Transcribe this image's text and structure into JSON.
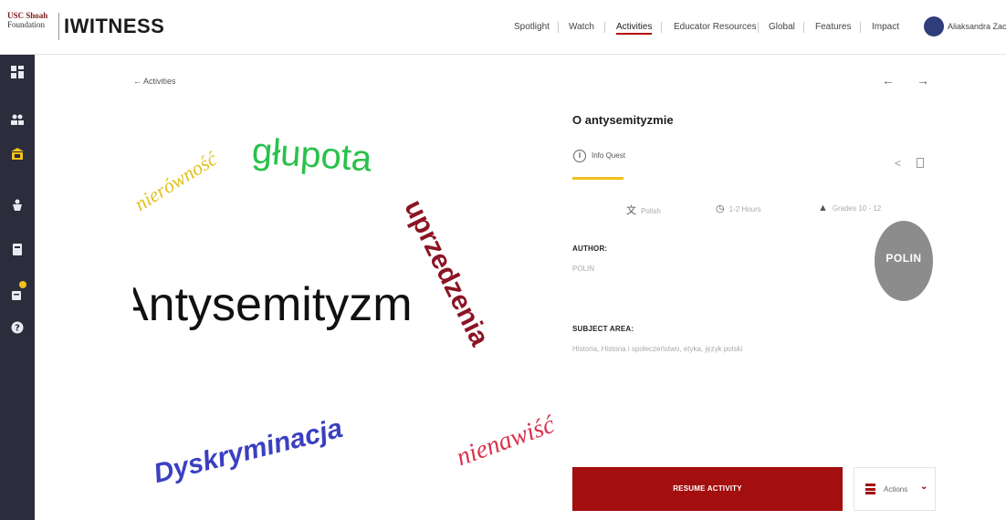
{
  "header": {
    "usc_logo_line1": "USC Shoah",
    "usc_logo_line2": "Foundation",
    "brand": "IWITNESS",
    "nav": [
      "Spotlight",
      "Watch",
      "Activities",
      "Educator Resources",
      "Global",
      "Features",
      "Impact"
    ],
    "active_nav": "Activities",
    "username": "Aliaksandra Zacharova"
  },
  "sidebar": {
    "icons": [
      "dashboard-icon",
      "people-icon",
      "activities-icon",
      "trophy-icon",
      "clipboard-icon",
      "notifications-icon",
      "help-icon"
    ],
    "active": "activities-icon",
    "accent": "#f2c21b"
  },
  "breadcrumb": {
    "back_label": "Activities"
  },
  "hero_words": {
    "w1": "nierówność",
    "w2": "głupota",
    "w3": "uprzedzenia",
    "w4": "Antysemityzm",
    "w5": "Dyskryminacja",
    "w6": "nienawiść"
  },
  "activity": {
    "title": "O antysemityzmie",
    "tab_label": "Info Quest",
    "language": "Polish",
    "duration": "1-2 Hours",
    "grades": "Grades 10 - 12",
    "author_label": "AUTHOR:",
    "author_value": "POLIN",
    "subject_label": "SUBJECT AREA:",
    "subject_value": "Historia, Historia i społeczeństwo, etyka, język polski",
    "org_logo_text": "POLIN"
  },
  "buttons": {
    "resume": "RESUME ACTIVITY",
    "actions": "Actions"
  },
  "colors": {
    "brand_red": "#a30e0e",
    "sidebar_bg": "#2b2d3c",
    "tab_underline": "#f2c21b"
  }
}
